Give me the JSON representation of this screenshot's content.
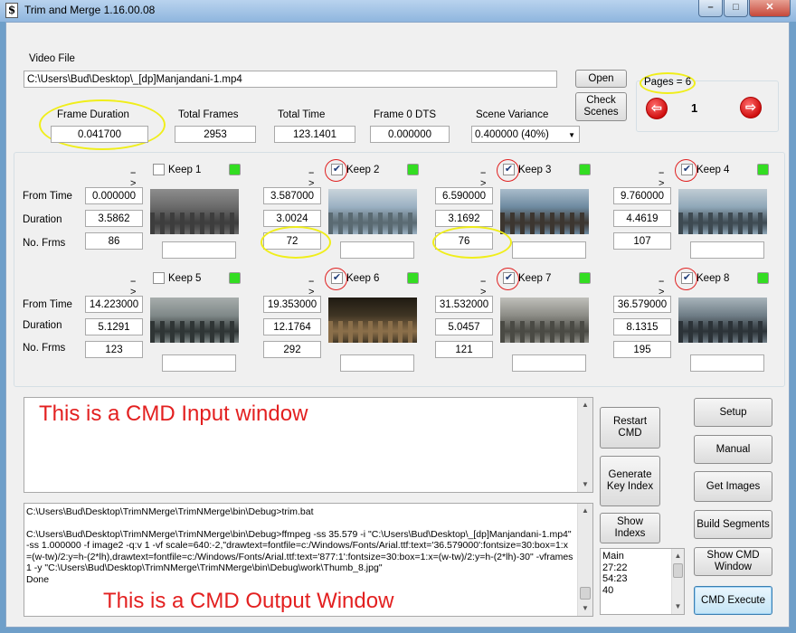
{
  "window": {
    "title": "Trim and Merge 1.16.00.08",
    "min": "–",
    "max": "□",
    "close": "✕"
  },
  "video_file": {
    "label": "Video File",
    "path": "C:\\Users\\Bud\\Desktop\\_[dp]Manjandani-1.mp4"
  },
  "buttons": {
    "open": "Open",
    "check_scenes": "Check Scenes",
    "restart_cmd": "Restart CMD",
    "generate_key_index": "Generate Key Index",
    "show_indexs": "Show Indexs",
    "setup": "Setup",
    "manual": "Manual",
    "get_images": "Get Images",
    "build_segments": "Build Segments",
    "show_cmd_window": "Show CMD Window",
    "cmd_execute": "CMD Execute"
  },
  "stats": {
    "frame_duration_label": "Frame Duration",
    "frame_duration": "0.041700",
    "total_frames_label": "Total Frames",
    "total_frames": "2953",
    "total_time_label": "Total Time",
    "total_time": "123.1401",
    "frame0_dts_label": "Frame 0 DTS",
    "frame0_dts": "0.000000",
    "scene_variance_label": "Scene Variance",
    "scene_variance": "0.400000   (40%)"
  },
  "pages": {
    "label": "Pages = 6",
    "current": "1"
  },
  "row_labels": {
    "from_time": "From Time",
    "duration": "Duration",
    "no_frms": "No. Frms"
  },
  "arrow_glyph": "-->",
  "scenes": [
    {
      "keep_label": "Keep 1",
      "checked": false,
      "from": "0.000000",
      "duration": "3.5862",
      "frames": "86"
    },
    {
      "keep_label": "Keep 2",
      "checked": true,
      "from": "3.587000",
      "duration": "3.0024",
      "frames": "72"
    },
    {
      "keep_label": "Keep 3",
      "checked": true,
      "from": "6.590000",
      "duration": "3.1692",
      "frames": "76"
    },
    {
      "keep_label": "Keep 4",
      "checked": true,
      "from": "9.760000",
      "duration": "4.4619",
      "frames": "107"
    },
    {
      "keep_label": "Keep 5",
      "checked": false,
      "from": "14.223000",
      "duration": "5.1291",
      "frames": "123"
    },
    {
      "keep_label": "Keep 6",
      "checked": true,
      "from": "19.353000",
      "duration": "12.1764",
      "frames": "292"
    },
    {
      "keep_label": "Keep 7",
      "checked": true,
      "from": "31.532000",
      "duration": "5.0457",
      "frames": "121"
    },
    {
      "keep_label": "Keep 8",
      "checked": true,
      "from": "36.579000",
      "duration": "8.1315",
      "frames": "195"
    }
  ],
  "cmd_input": {
    "annotation": "This is a CMD Input window"
  },
  "cmd_output": {
    "line1": "C:\\Users\\Bud\\Desktop\\TrimNMerge\\TrimNMerge\\bin\\Debug>trim.bat",
    "line2": "C:\\Users\\Bud\\Desktop\\TrimNMerge\\TrimNMerge\\bin\\Debug>ffmpeg -ss 35.579 -i \"C:\\Users\\Bud\\Desktop\\_[dp]Manjandani-1.mp4\" -ss 1.000000 -f image2 -q:v 1 -vf scale=640:-2,\"drawtext=fontfile=c:/Windows/Fonts/Arial.ttf:text='36.579000':fontsize=30:box=1:x=(w-tw)/2:y=h-(2*lh),drawtext=fontfile=c:/Windows/Fonts/Arial.ttf:text='877:1':fontsize=30:box=1:x=(w-tw)/2:y=h-(2*lh)-30\" -vframes 1 -y \"C:\\Users\\Bud\\Desktop\\TrimNMerge\\TrimNMerge\\bin\\Debug\\work\\Thumb_8.jpg\"",
    "line3": "Done",
    "annotation": "This is a CMD Output Window"
  },
  "index_list": [
    "Main",
    "27:22",
    "54:23",
    "40"
  ]
}
